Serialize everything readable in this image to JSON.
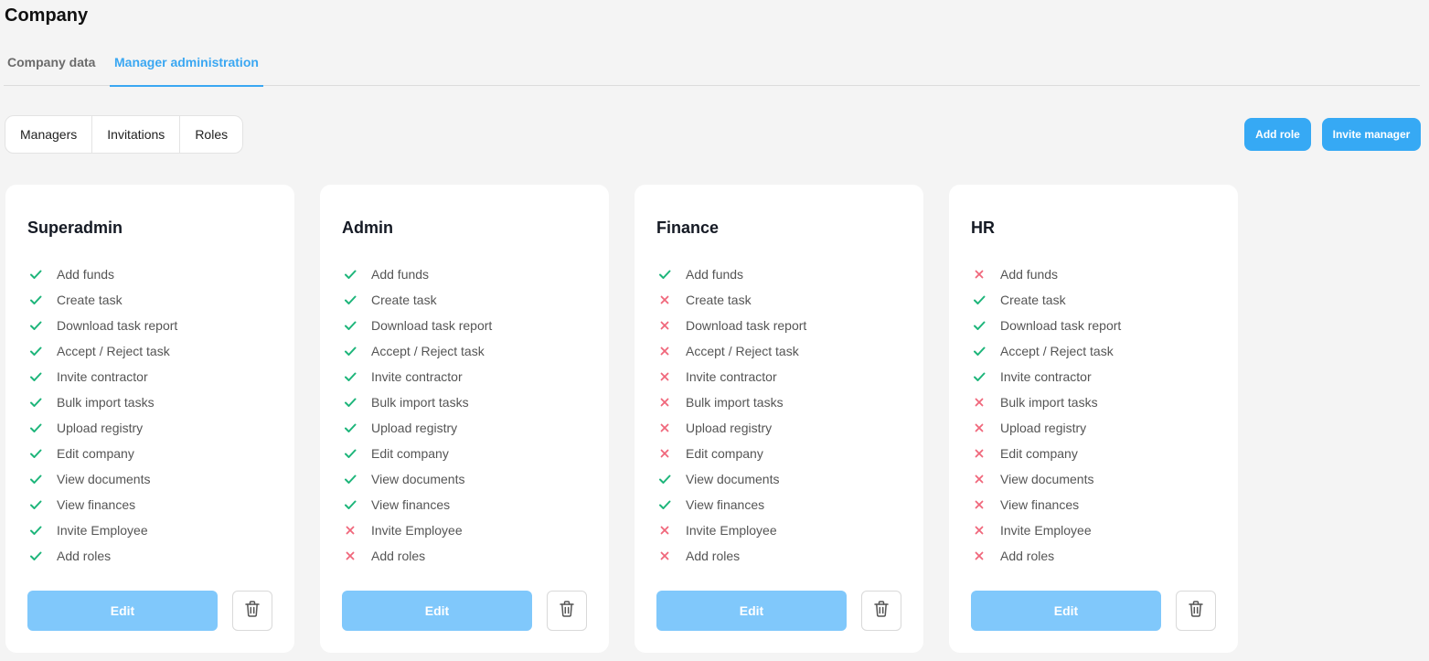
{
  "page": {
    "title": "Company"
  },
  "tabs": [
    {
      "label": "Company data",
      "active": false
    },
    {
      "label": "Manager administration",
      "active": true
    }
  ],
  "segments": [
    {
      "label": "Managers"
    },
    {
      "label": "Invitations"
    },
    {
      "label": "Roles"
    }
  ],
  "actions": {
    "add_role": "Add role",
    "invite_manager": "Invite manager"
  },
  "colors": {
    "accent": "#36a9f4",
    "edit_button": "#80c8fb",
    "allowed": "#1db57a",
    "denied": "#f0677b"
  },
  "icons": {
    "allowed": "check-icon",
    "denied": "cross-icon",
    "delete": "trash-icon"
  },
  "edit_label": "Edit",
  "roles": [
    {
      "name": "Superadmin",
      "permissions": [
        {
          "label": "Add funds",
          "allowed": true
        },
        {
          "label": "Create task",
          "allowed": true
        },
        {
          "label": "Download task report",
          "allowed": true
        },
        {
          "label": "Accept / Reject task",
          "allowed": true
        },
        {
          "label": "Invite contractor",
          "allowed": true
        },
        {
          "label": "Bulk import tasks",
          "allowed": true
        },
        {
          "label": "Upload registry",
          "allowed": true
        },
        {
          "label": "Edit company",
          "allowed": true
        },
        {
          "label": "View documents",
          "allowed": true
        },
        {
          "label": "View finances",
          "allowed": true
        },
        {
          "label": "Invite Employee",
          "allowed": true
        },
        {
          "label": "Add roles",
          "allowed": true
        }
      ]
    },
    {
      "name": "Admin",
      "permissions": [
        {
          "label": "Add funds",
          "allowed": true
        },
        {
          "label": "Create task",
          "allowed": true
        },
        {
          "label": "Download task report",
          "allowed": true
        },
        {
          "label": "Accept / Reject task",
          "allowed": true
        },
        {
          "label": "Invite contractor",
          "allowed": true
        },
        {
          "label": "Bulk import tasks",
          "allowed": true
        },
        {
          "label": "Upload registry",
          "allowed": true
        },
        {
          "label": "Edit company",
          "allowed": true
        },
        {
          "label": "View documents",
          "allowed": true
        },
        {
          "label": "View finances",
          "allowed": true
        },
        {
          "label": "Invite Employee",
          "allowed": false
        },
        {
          "label": "Add roles",
          "allowed": false
        }
      ]
    },
    {
      "name": "Finance",
      "permissions": [
        {
          "label": "Add funds",
          "allowed": true
        },
        {
          "label": "Create task",
          "allowed": false
        },
        {
          "label": "Download task report",
          "allowed": false
        },
        {
          "label": "Accept / Reject task",
          "allowed": false
        },
        {
          "label": "Invite contractor",
          "allowed": false
        },
        {
          "label": "Bulk import tasks",
          "allowed": false
        },
        {
          "label": "Upload registry",
          "allowed": false
        },
        {
          "label": "Edit company",
          "allowed": false
        },
        {
          "label": "View documents",
          "allowed": true
        },
        {
          "label": "View finances",
          "allowed": true
        },
        {
          "label": "Invite Employee",
          "allowed": false
        },
        {
          "label": "Add roles",
          "allowed": false
        }
      ]
    },
    {
      "name": "HR",
      "permissions": [
        {
          "label": "Add funds",
          "allowed": false
        },
        {
          "label": "Create task",
          "allowed": true
        },
        {
          "label": "Download task report",
          "allowed": true
        },
        {
          "label": "Accept / Reject task",
          "allowed": true
        },
        {
          "label": "Invite contractor",
          "allowed": true
        },
        {
          "label": "Bulk import tasks",
          "allowed": false
        },
        {
          "label": "Upload registry",
          "allowed": false
        },
        {
          "label": "Edit company",
          "allowed": false
        },
        {
          "label": "View documents",
          "allowed": false
        },
        {
          "label": "View finances",
          "allowed": false
        },
        {
          "label": "Invite Employee",
          "allowed": false
        },
        {
          "label": "Add roles",
          "allowed": false
        }
      ]
    }
  ]
}
